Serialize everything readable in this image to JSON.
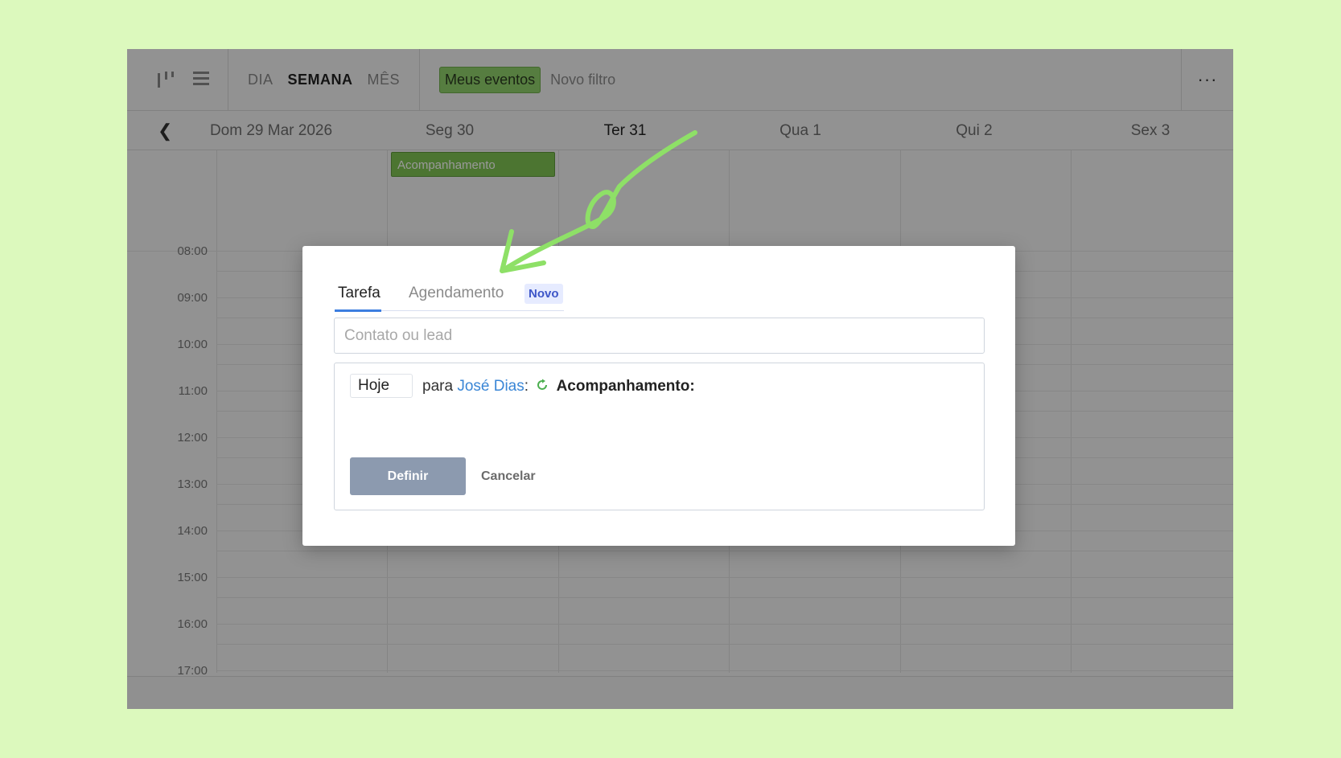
{
  "toolbar": {
    "view_tabs": [
      "DIA",
      "SEMANA",
      "MÊS"
    ],
    "active_view": "SEMANA",
    "filter_active": "Meus eventos",
    "filter_new": "Novo filtro",
    "more": "···"
  },
  "datebar": {
    "prev_icon": "chevron-left-icon",
    "days": [
      "Dom 29 Mar 2026",
      "Seg 30",
      "Ter 31",
      "Qua 1",
      "Qui 2",
      "Sex 3"
    ],
    "today": "Ter 31"
  },
  "grid": {
    "times": [
      "08:00",
      "09:00",
      "10:00",
      "11:00",
      "12:00",
      "13:00",
      "14:00",
      "15:00",
      "16:00",
      "17:00"
    ],
    "event_label": "Acompanhamento",
    "event_color": "#7fc353"
  },
  "modal": {
    "tab_task": "Tarefa",
    "tab_schedule": "Agendamento",
    "badge_new": "Novo",
    "contact_placeholder": "Contato ou lead",
    "date_value": "Hoje",
    "for_text": "para",
    "contact_name": "José Dias",
    "colon": ":",
    "task_type": "Acompanhamento:",
    "submit_label": "Definir",
    "cancel_label": "Cancelar"
  },
  "colors": {
    "background": "#dcf9bd",
    "accent_green": "#8fd06b",
    "link_blue": "#3a86d6",
    "arrow": "#8ee067"
  }
}
